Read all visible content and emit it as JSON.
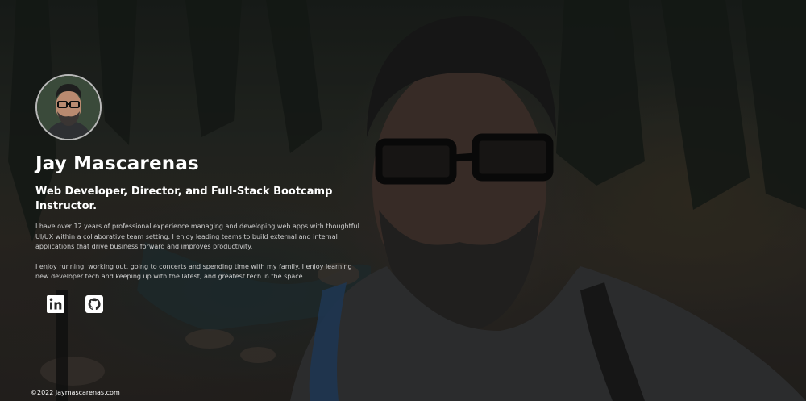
{
  "profile": {
    "name": "Jay Mascarenas",
    "tagline": "Web Developer, Director, and Full-Stack Bootcamp Instructor.",
    "bio_paragraph_1": "I have over 12 years of professional experience managing and developing web apps with thoughtful UI/UX within a collaborative team setting. I enjoy leading teams to build external and internal applications that drive business forward and improves productivity.",
    "bio_paragraph_2": "I enjoy running, working out, going to concerts and spending time with my family. I enjoy learning new developer tech and keeping up with the latest, and greatest tech in the space."
  },
  "socials": [
    {
      "icon": "linkedin-icon"
    },
    {
      "icon": "github-icon"
    }
  ],
  "footer": {
    "copyright": "©2022 jaymascarenas.com"
  },
  "colors": {
    "text": "#ffffff",
    "muted_text": "#d0d0d0"
  }
}
